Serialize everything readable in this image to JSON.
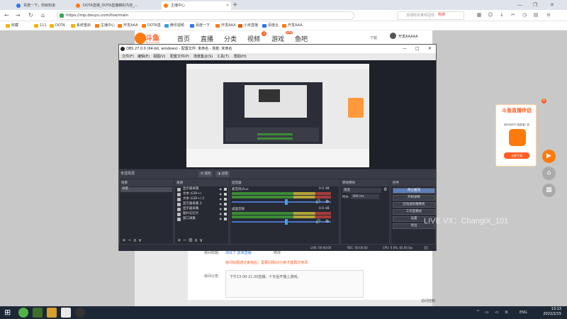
{
  "browser": {
    "tabs": [
      {
        "label": "百度一下，你就知道",
        "color": "#3073f1"
      },
      {
        "label": "DOTA直播_DOTA直播精彩内容_...",
        "color": "#ff7a0c"
      },
      {
        "label": "主播中心",
        "color": "#ff7a0c"
      }
    ],
    "url": "https://mp.douyu.com/live/main",
    "search_placeholder": "苏翊鸣冬奥夺冠夺",
    "hot_label": "热搜",
    "bookmarks": [
      "收藏",
      "111",
      "DOTA",
      "系统重启",
      "主播中心",
      "开发AAA",
      "DOTA直",
      "腾讯视频",
      "百度一下",
      "开发AAA",
      "小米直播",
      "百度云",
      "开发AAA"
    ]
  },
  "douyu": {
    "logo_text": "斗鱼",
    "logo_sub": "DOUYU.COM",
    "nav": [
      "首页",
      "直播",
      "分类",
      "视频",
      "游戏",
      "鱼吧"
    ],
    "video_badge": "3",
    "game_badge": "NEW",
    "download": "下载",
    "username": "开发AAAAA",
    "form": {
      "title_label": "房间标题:",
      "title_value": "测试了 直来直播",
      "edit_link": "修改",
      "warning": "房间标题通过审核后，需要间隔10分钟才能再次修改",
      "notice_label": "房间公告:",
      "notice_value": "下午13.00-21.00直播。十天后开播上游戏。"
    },
    "promo": {
      "title": "斗鱼直播伴侣",
      "desc": "超好用的PC端直播工具",
      "button": "立即下载",
      "close": "×"
    }
  },
  "obs": {
    "title": "OBS 27.0.0 (64-bit, windows) - 配置文件: 未命名 - 场景: 未命名",
    "menu": [
      "文件(F)",
      "编辑(E)",
      "视图(V)",
      "配置文件(P)",
      "场景集合(S)",
      "工具(T)",
      "帮助(H)"
    ],
    "scene_label": "未选择源",
    "props_button": "属性",
    "filters_button": "滤镜",
    "scenes_header": "场景",
    "scenes": [
      "场景"
    ],
    "sources_header": "来源",
    "sources": [
      "显示器采集",
      "文本 (GDI+)",
      "文本 (GDI+) 2",
      "显示器采集 2",
      "显示器采集",
      "图片幻灯片",
      "窗口采集"
    ],
    "mixer_header": "混音器",
    "mixer": [
      {
        "name": "麦克风/Aux",
        "db": "0.0 dB"
      },
      {
        "name": "桌面音频",
        "db": "0.0 dB"
      }
    ],
    "transition_header": "转场特效",
    "transition": "渐变",
    "duration_label": "时长",
    "duration": "300 ms",
    "controls_header": "控件",
    "controls": [
      "停止推流",
      "开始录制",
      "启动虚拟摄像机",
      "工作室模式",
      "设置",
      "退出"
    ],
    "status": {
      "live": "LIVE: 00:00:00",
      "rec": "REC: 00:00:00",
      "cpu": "CPU: 0.0%, 60.00 fps"
    }
  },
  "watermark": "LIVE VX：ChangiX_101",
  "bottom_right": "访问控制",
  "taskbar": {
    "time": "13:13",
    "date": "2022/2/15",
    "lang": "ENG"
  }
}
